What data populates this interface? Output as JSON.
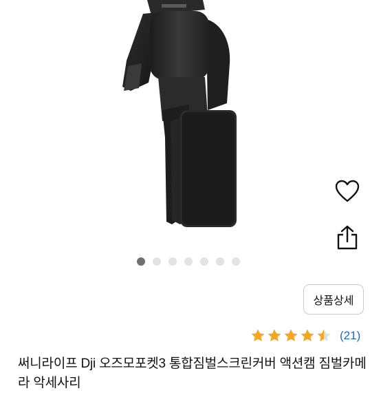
{
  "gallery": {
    "total_images": 7,
    "active_index": 0
  },
  "actions": {
    "detail_label": "상품상세",
    "wishlist_icon": "heart-icon",
    "share_icon": "share-icon"
  },
  "rating": {
    "value": 4.5,
    "max": 5,
    "count_text": "(21)",
    "star_color": "#f5a623"
  },
  "product": {
    "title": "써니라이프 Dji 오즈모포켓3 통합짐벌스크린커버 액션캠 짐벌카메라 악세사리"
  }
}
